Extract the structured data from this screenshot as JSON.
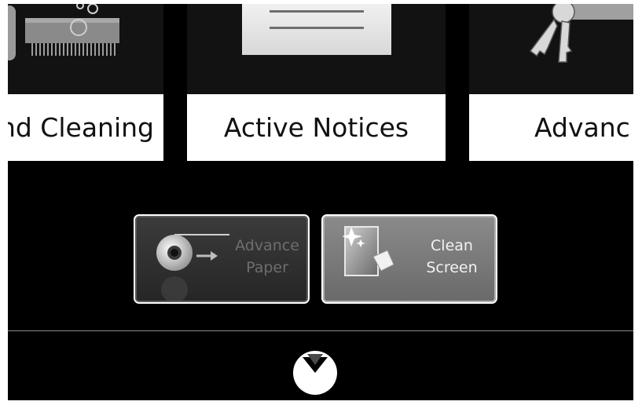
{
  "cards": [
    {
      "label": "nd Cleaning",
      "icon": "shredder-icon"
    },
    {
      "label": "Active Notices",
      "icon": "notice-paper-icon"
    },
    {
      "label": "Advanc",
      "icon": "keys-icon"
    }
  ],
  "actions": {
    "advance_paper": {
      "line1": "Advance",
      "line2": "Paper",
      "icon": "paper-roll-icon"
    },
    "clean_screen": {
      "line1": "Clean",
      "line2": "Screen",
      "icon": "wipe-screen-icon"
    }
  },
  "footer": {
    "icon": "chevron-down-icon"
  },
  "colors": {
    "background": "#000000",
    "card": "#ffffff",
    "divider": "#8a8a8a"
  }
}
